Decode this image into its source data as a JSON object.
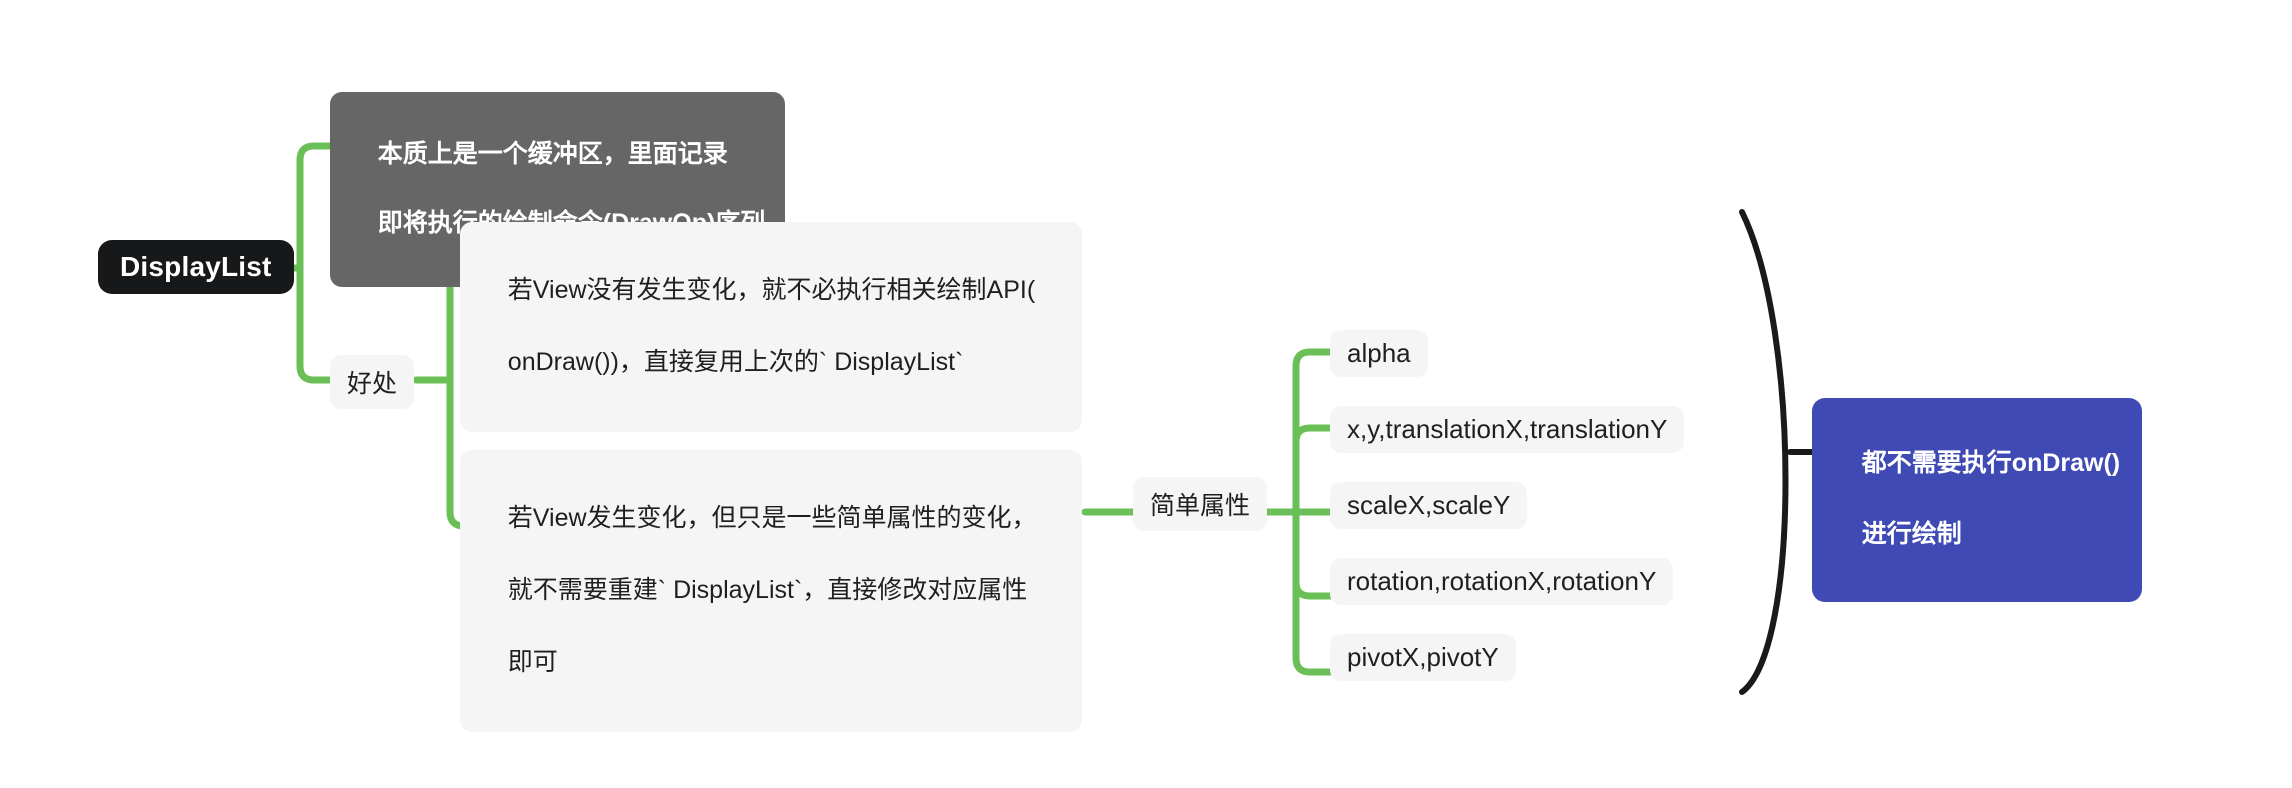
{
  "diagram": {
    "type": "mindmap",
    "title": "DisplayList",
    "background_color": "#ffffff",
    "connector_color": "#6abf56",
    "bracket_color": "#1a1a1a"
  },
  "root": {
    "label": "DisplayList",
    "bg_color": "#17181a",
    "text_color": "#ffffff"
  },
  "definition": {
    "line1": "本质上是一个缓冲区，里面记录",
    "line2": "即将执行的绘制命令(DrawOp)序列",
    "bg_color": "#666666",
    "text_color": "#ffffff"
  },
  "benefits": {
    "label": "好处",
    "items": [
      {
        "line1": "若View没有发生变化，就不必执行相关绘制API(",
        "line2": "onDraw())，直接复用上次的` DisplayList`"
      },
      {
        "line1": "若View发生变化，但只是一些简单属性的变化，",
        "line2": "就不需要重建` DisplayList`，直接修改对应属性",
        "line3": "即可"
      }
    ]
  },
  "simple_properties": {
    "label": "简单属性",
    "items": [
      "alpha",
      "x,y,translationX,translationY",
      "scaleX,scaleY",
      "rotation,rotationX,rotationY",
      "pivotX,pivotY"
    ]
  },
  "conclusion": {
    "line1": "都不需要执行onDraw()",
    "line2": "进行绘制",
    "bg_color": "#3f4ab5",
    "text_color": "#ffffff"
  }
}
